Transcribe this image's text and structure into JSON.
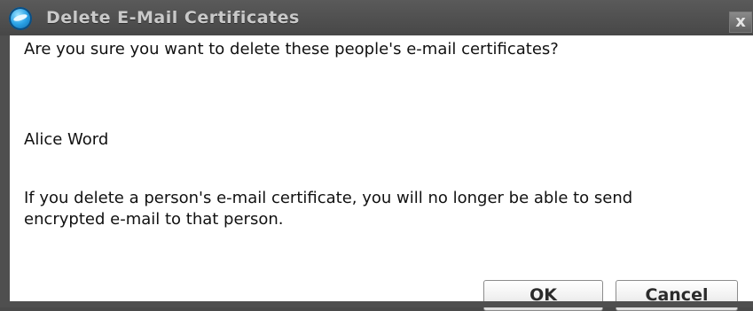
{
  "dialog": {
    "title": "Delete E-Mail Certificates",
    "close_label": "x",
    "question": "Are you sure you want to delete these people's e-mail certificates?",
    "person": "Alice Word",
    "warning_line1": "If you delete a person's e-mail certificate, you will no longer be able to send",
    "warning_line2": "encrypted e-mail to that person.",
    "ok_label": "OK",
    "cancel_label": "Cancel"
  },
  "icons": {
    "app": "app-globe-icon",
    "close": "close-icon"
  },
  "colors": {
    "titlebar": "#4f4f4f",
    "content_bg": "#ffffff",
    "title_text": "#c9c9c9"
  }
}
